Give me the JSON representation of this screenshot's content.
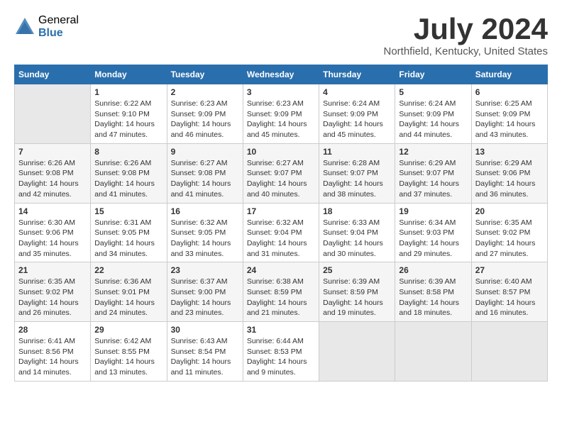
{
  "header": {
    "logo_general": "General",
    "logo_blue": "Blue",
    "title": "July 2024",
    "location": "Northfield, Kentucky, United States"
  },
  "days_of_week": [
    "Sunday",
    "Monday",
    "Tuesday",
    "Wednesday",
    "Thursday",
    "Friday",
    "Saturday"
  ],
  "weeks": [
    [
      {
        "day": "",
        "info": ""
      },
      {
        "day": "1",
        "info": "Sunrise: 6:22 AM\nSunset: 9:10 PM\nDaylight: 14 hours\nand 47 minutes."
      },
      {
        "day": "2",
        "info": "Sunrise: 6:23 AM\nSunset: 9:09 PM\nDaylight: 14 hours\nand 46 minutes."
      },
      {
        "day": "3",
        "info": "Sunrise: 6:23 AM\nSunset: 9:09 PM\nDaylight: 14 hours\nand 45 minutes."
      },
      {
        "day": "4",
        "info": "Sunrise: 6:24 AM\nSunset: 9:09 PM\nDaylight: 14 hours\nand 45 minutes."
      },
      {
        "day": "5",
        "info": "Sunrise: 6:24 AM\nSunset: 9:09 PM\nDaylight: 14 hours\nand 44 minutes."
      },
      {
        "day": "6",
        "info": "Sunrise: 6:25 AM\nSunset: 9:09 PM\nDaylight: 14 hours\nand 43 minutes."
      }
    ],
    [
      {
        "day": "7",
        "info": "Sunrise: 6:26 AM\nSunset: 9:08 PM\nDaylight: 14 hours\nand 42 minutes."
      },
      {
        "day": "8",
        "info": "Sunrise: 6:26 AM\nSunset: 9:08 PM\nDaylight: 14 hours\nand 41 minutes."
      },
      {
        "day": "9",
        "info": "Sunrise: 6:27 AM\nSunset: 9:08 PM\nDaylight: 14 hours\nand 41 minutes."
      },
      {
        "day": "10",
        "info": "Sunrise: 6:27 AM\nSunset: 9:07 PM\nDaylight: 14 hours\nand 40 minutes."
      },
      {
        "day": "11",
        "info": "Sunrise: 6:28 AM\nSunset: 9:07 PM\nDaylight: 14 hours\nand 38 minutes."
      },
      {
        "day": "12",
        "info": "Sunrise: 6:29 AM\nSunset: 9:07 PM\nDaylight: 14 hours\nand 37 minutes."
      },
      {
        "day": "13",
        "info": "Sunrise: 6:29 AM\nSunset: 9:06 PM\nDaylight: 14 hours\nand 36 minutes."
      }
    ],
    [
      {
        "day": "14",
        "info": "Sunrise: 6:30 AM\nSunset: 9:06 PM\nDaylight: 14 hours\nand 35 minutes."
      },
      {
        "day": "15",
        "info": "Sunrise: 6:31 AM\nSunset: 9:05 PM\nDaylight: 14 hours\nand 34 minutes."
      },
      {
        "day": "16",
        "info": "Sunrise: 6:32 AM\nSunset: 9:05 PM\nDaylight: 14 hours\nand 33 minutes."
      },
      {
        "day": "17",
        "info": "Sunrise: 6:32 AM\nSunset: 9:04 PM\nDaylight: 14 hours\nand 31 minutes."
      },
      {
        "day": "18",
        "info": "Sunrise: 6:33 AM\nSunset: 9:04 PM\nDaylight: 14 hours\nand 30 minutes."
      },
      {
        "day": "19",
        "info": "Sunrise: 6:34 AM\nSunset: 9:03 PM\nDaylight: 14 hours\nand 29 minutes."
      },
      {
        "day": "20",
        "info": "Sunrise: 6:35 AM\nSunset: 9:02 PM\nDaylight: 14 hours\nand 27 minutes."
      }
    ],
    [
      {
        "day": "21",
        "info": "Sunrise: 6:35 AM\nSunset: 9:02 PM\nDaylight: 14 hours\nand 26 minutes."
      },
      {
        "day": "22",
        "info": "Sunrise: 6:36 AM\nSunset: 9:01 PM\nDaylight: 14 hours\nand 24 minutes."
      },
      {
        "day": "23",
        "info": "Sunrise: 6:37 AM\nSunset: 9:00 PM\nDaylight: 14 hours\nand 23 minutes."
      },
      {
        "day": "24",
        "info": "Sunrise: 6:38 AM\nSunset: 8:59 PM\nDaylight: 14 hours\nand 21 minutes."
      },
      {
        "day": "25",
        "info": "Sunrise: 6:39 AM\nSunset: 8:59 PM\nDaylight: 14 hours\nand 19 minutes."
      },
      {
        "day": "26",
        "info": "Sunrise: 6:39 AM\nSunset: 8:58 PM\nDaylight: 14 hours\nand 18 minutes."
      },
      {
        "day": "27",
        "info": "Sunrise: 6:40 AM\nSunset: 8:57 PM\nDaylight: 14 hours\nand 16 minutes."
      }
    ],
    [
      {
        "day": "28",
        "info": "Sunrise: 6:41 AM\nSunset: 8:56 PM\nDaylight: 14 hours\nand 14 minutes."
      },
      {
        "day": "29",
        "info": "Sunrise: 6:42 AM\nSunset: 8:55 PM\nDaylight: 14 hours\nand 13 minutes."
      },
      {
        "day": "30",
        "info": "Sunrise: 6:43 AM\nSunset: 8:54 PM\nDaylight: 14 hours\nand 11 minutes."
      },
      {
        "day": "31",
        "info": "Sunrise: 6:44 AM\nSunset: 8:53 PM\nDaylight: 14 hours\nand 9 minutes."
      },
      {
        "day": "",
        "info": ""
      },
      {
        "day": "",
        "info": ""
      },
      {
        "day": "",
        "info": ""
      }
    ]
  ]
}
